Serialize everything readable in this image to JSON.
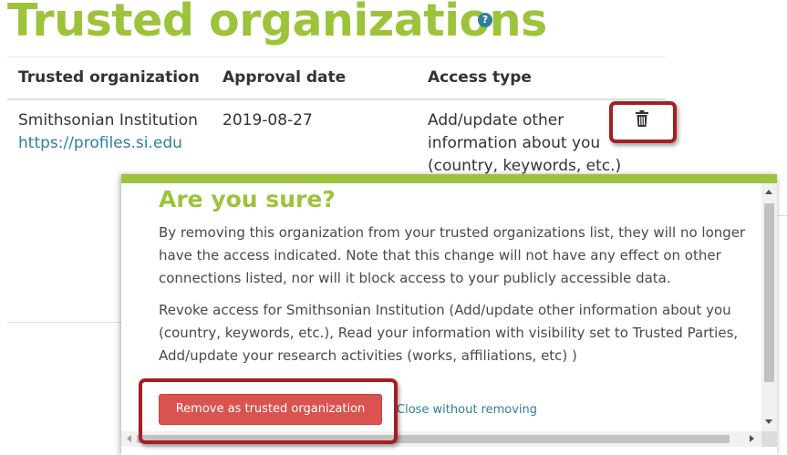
{
  "page": {
    "title": "Trusted organizations",
    "help_icon": "question-circle-icon"
  },
  "table": {
    "columns": [
      "Trusted organization",
      "Approval date",
      "Access type"
    ],
    "rows": [
      {
        "organization": "Smithsonian Institution",
        "url": "https://profiles.si.edu",
        "approval_date": "2019-08-27",
        "access_lines": [
          "Add/update other",
          "information about you",
          "(country, keywords, etc.)"
        ],
        "delete_icon": "trash-icon"
      }
    ]
  },
  "modal": {
    "title": "Are you sure?",
    "paragraph1": "By removing this organization from your trusted organizations list, they will no longer have the access indicated. Note that this change will not have any effect on other connections listed, nor will it block access to your publicly accessible data.",
    "paragraph2": "Revoke access for Smithsonian Institution (Add/update other information about you (country, keywords, etc.), Read your information with visibility set to Trusted Parties, Add/update your research activities (works, affiliations, etc) )",
    "remove_button": "Remove as trusted organization",
    "close_link": "Close without removing"
  },
  "colors": {
    "brand_green": "#9dc33b",
    "link_blue": "#2e7f9a",
    "danger_red": "#d9534f",
    "highlight_red": "#a51e22"
  }
}
